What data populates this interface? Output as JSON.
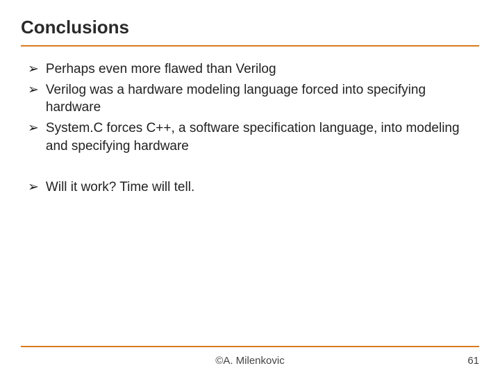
{
  "slide": {
    "title": "Conclusions",
    "bullets_group1": [
      "Perhaps even more flawed than Verilog",
      "Verilog was a hardware modeling language forced into specifying hardware",
      "System.C forces C++, a software specification language, into modeling and specifying hardware"
    ],
    "bullets_group2": [
      "Will it work? Time will tell."
    ]
  },
  "footer": {
    "author": "©A. Milenkovic",
    "page": "61"
  },
  "colors": {
    "accent": "#d97a1c"
  }
}
